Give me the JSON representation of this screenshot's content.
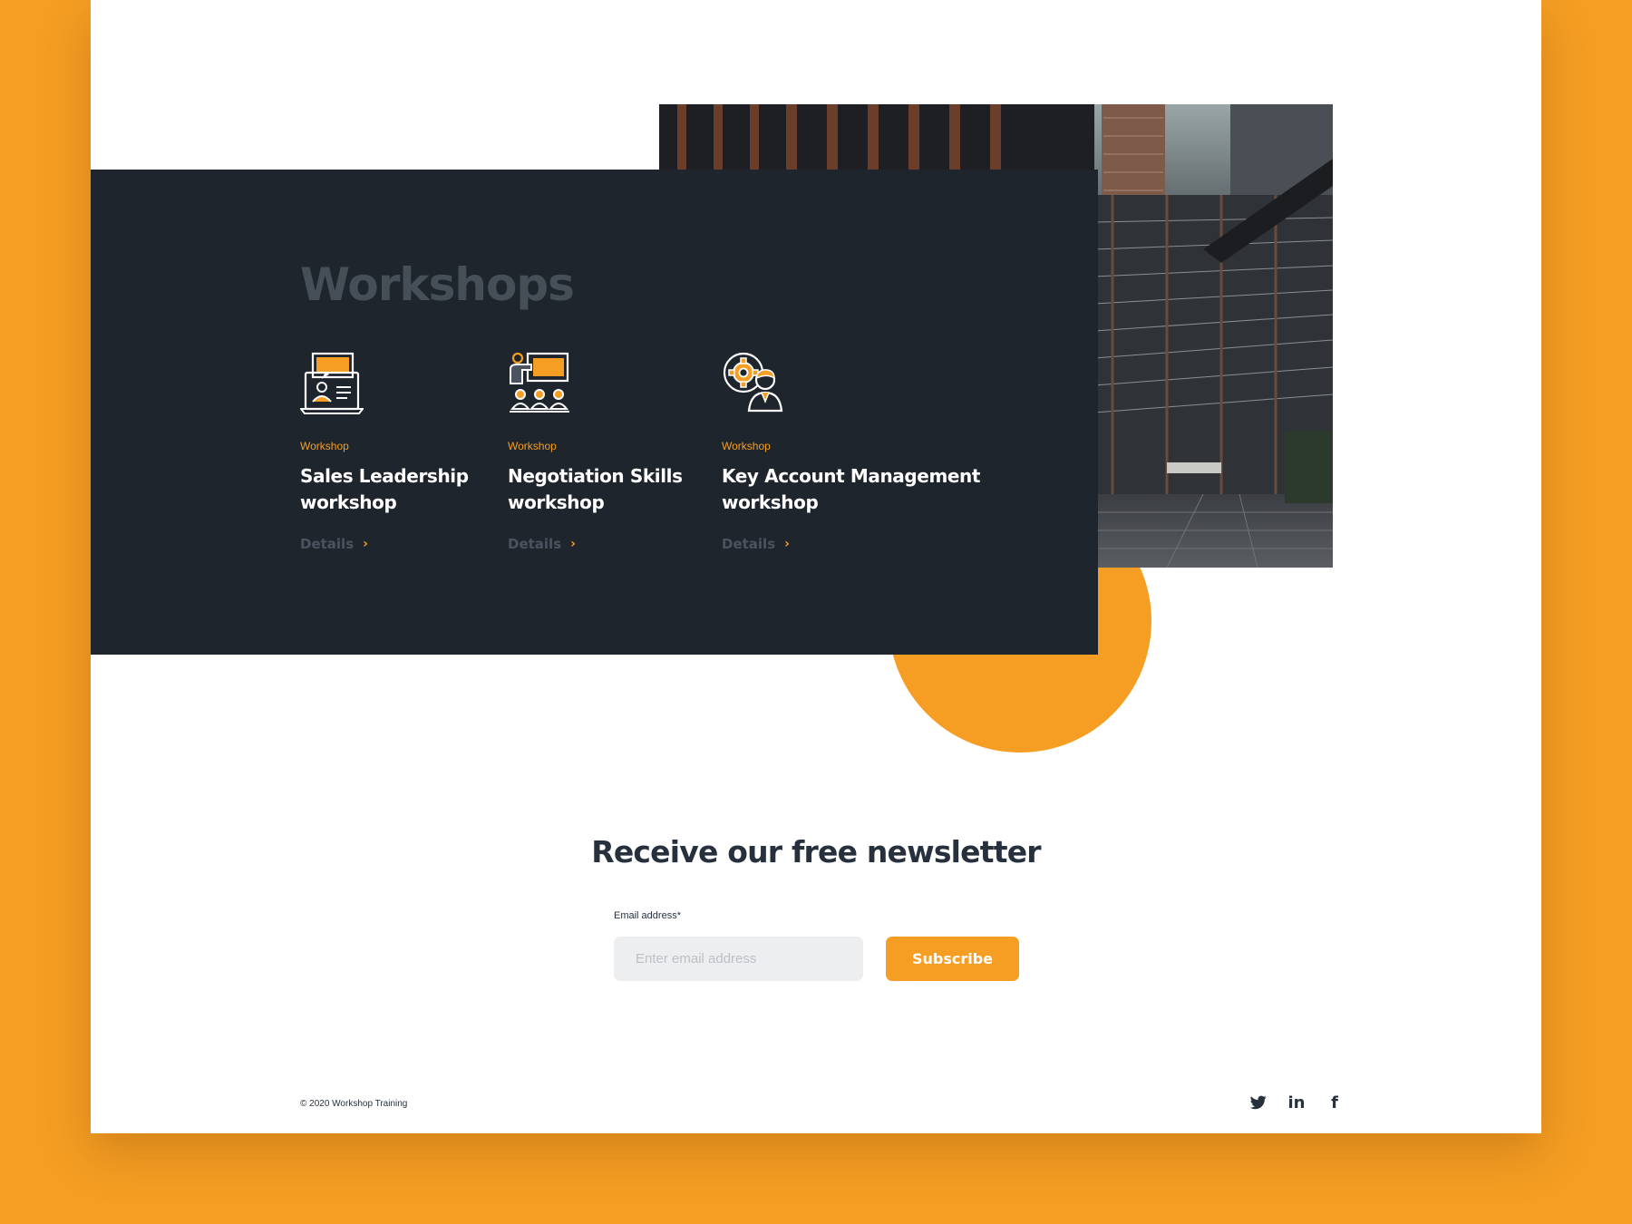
{
  "workshops": {
    "title": "Workshops",
    "items": [
      {
        "tag": "Workshop",
        "title": "Sales Leadership\nworkshop",
        "details": "Details",
        "icon": "presentation-laptop-icon"
      },
      {
        "tag": "Workshop",
        "title": "Negotiation Skills\nworkshop",
        "details": "Details",
        "icon": "classroom-presenter-icon"
      },
      {
        "tag": "Workshop",
        "title": "Key Account Management\nworkshop",
        "details": "Details",
        "icon": "gear-person-icon"
      }
    ]
  },
  "newsletter": {
    "title": "Receive our free newsletter",
    "email_label": "Email address*",
    "email_placeholder": "Enter email address",
    "email_value": "",
    "subscribe_label": "Subscribe"
  },
  "footer": {
    "copyright": "© 2020 Workshop Training",
    "socials": [
      "twitter-icon",
      "linkedin-icon",
      "facebook-icon"
    ],
    "linkedin_text": "in",
    "facebook_text": "f"
  },
  "colors": {
    "accent": "#F59E23",
    "panel": "#1F252D",
    "heading_dark": "#27313E",
    "muted": "#464E58"
  }
}
